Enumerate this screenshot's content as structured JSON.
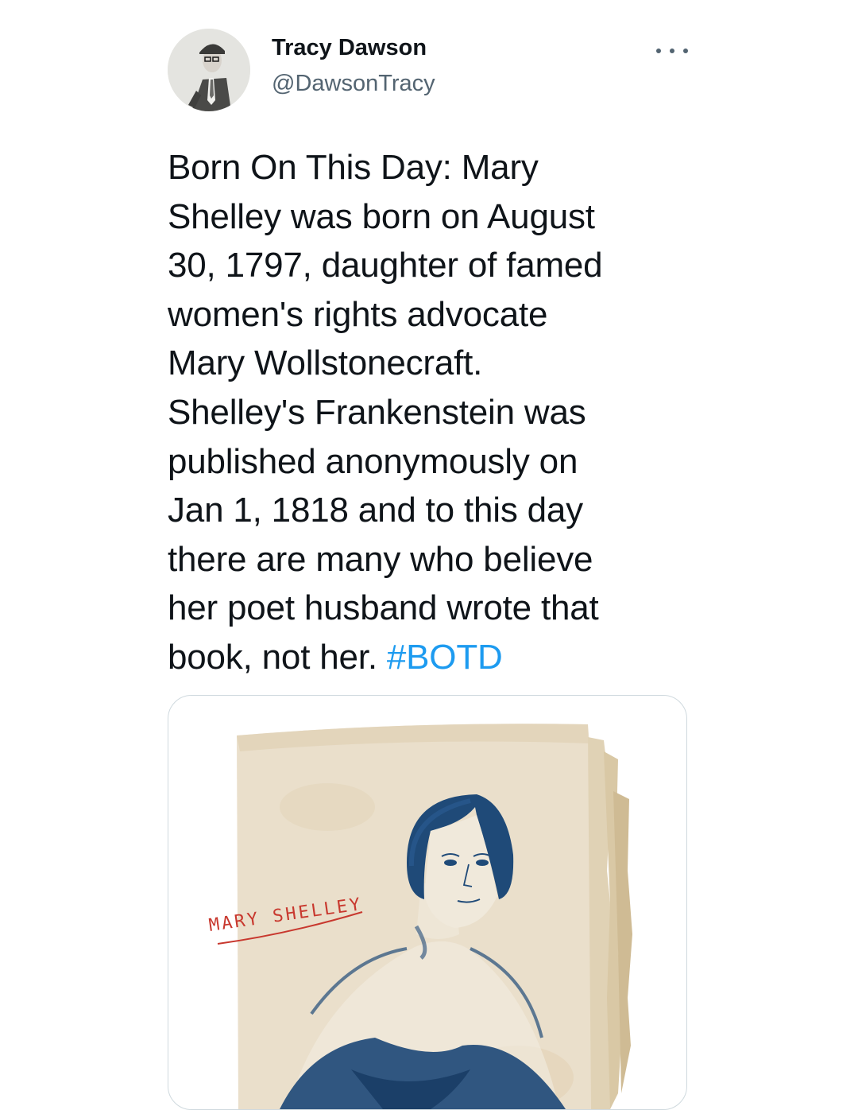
{
  "author": {
    "name": "Tracy Dawson",
    "handle": "@DawsonTracy",
    "avatar_icon": "profile-photo"
  },
  "menu": {
    "icon": "more-horizontal-icon"
  },
  "tweet": {
    "lines": [
      "Born On This Day: Mary",
      "Shelley was born on August",
      "30, 1797, daughter of famed",
      "women's rights advocate",
      "Mary Wollstonecraft.",
      "Shelley's Frankenstein was",
      "published anonymously on",
      "Jan 1, 1818 and to this day",
      "there are many who believe",
      "her poet husband wrote that",
      "book, not her."
    ],
    "hashtag": "#BOTD"
  },
  "media": {
    "handwritten_label": "MARY SHELLEY",
    "ink_color": "#1f4a78",
    "label_color": "#c8382e",
    "paper_color": "#eadfcb"
  },
  "colors": {
    "text": "#0f1419",
    "secondary": "#536471",
    "link": "#1d9bf0",
    "border": "#cfd9de"
  }
}
